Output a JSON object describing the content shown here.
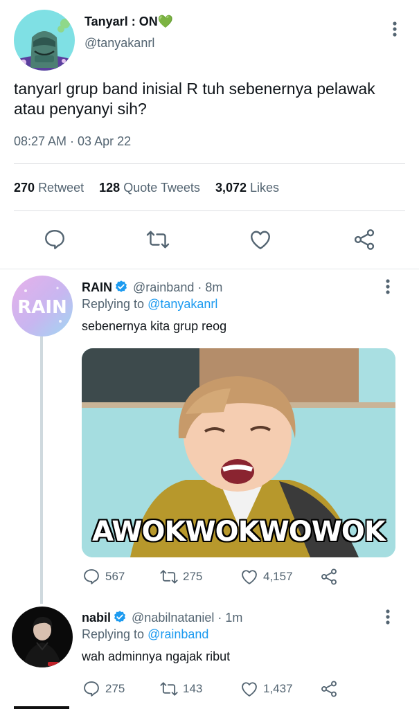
{
  "main_tweet": {
    "display_name": "Tanyarl : ON💚",
    "handle": "@tanyakanrl",
    "text": "tanyarl grup band inisial R tuh sebenernya pelawak atau penyanyi sih?",
    "timestamp": "08:27 AM · 03 Apr 22",
    "stats": {
      "retweets_count": "270",
      "retweets_label": "Retweet",
      "quotes_count": "128",
      "quotes_label": "Quote Tweets",
      "likes_count": "3,072",
      "likes_label": "Likes"
    },
    "actions": [
      "reply-icon",
      "retweet-icon",
      "like-icon",
      "share-icon"
    ]
  },
  "replies": [
    {
      "display_name": "RAIN",
      "avatar_text": "RAIN",
      "verified": true,
      "handle": "@rainband",
      "time": "· 8m",
      "replying_prefix": "Replying to",
      "replying_to": "@tanyakanrl",
      "text": "sebenernya kita grup reog",
      "media_caption": "AWOKWOKWOWOK",
      "reply_count": "567",
      "retweet_count": "275",
      "like_count": "4,157"
    },
    {
      "display_name": "nabil",
      "verified": true,
      "handle": "@nabilnataniel",
      "time": "· 1m",
      "replying_prefix": "Replying to",
      "replying_to": "@rainband",
      "text": "wah adminnya ngajak ribut",
      "reply_count": "275",
      "retweet_count": "143",
      "like_count": "1,437"
    }
  ],
  "colors": {
    "accent": "#1d9bf0",
    "text_primary": "#0f1419",
    "text_secondary": "#536471",
    "divider": "#dcdfe2",
    "verified": "#1d9bf0"
  }
}
